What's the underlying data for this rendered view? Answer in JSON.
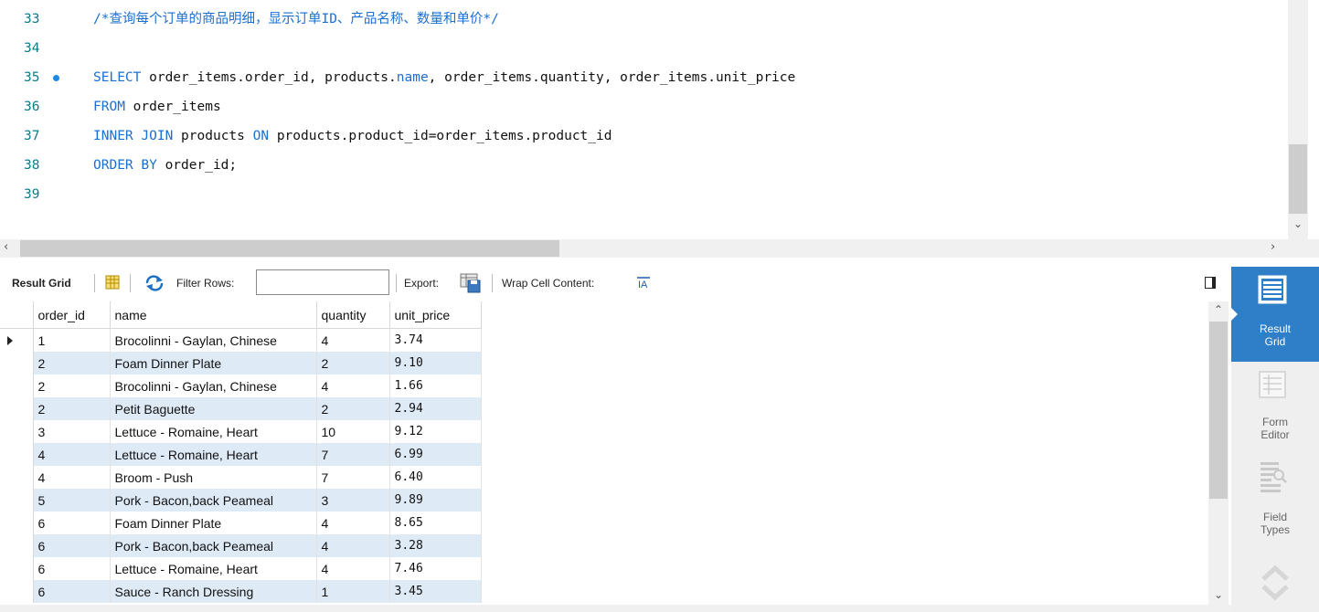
{
  "editor": {
    "lines": [
      {
        "num": "33",
        "parts": [
          {
            "t": "/*查询每个订单的商品明细，显示订单ID、产品名称、数量和单价*/",
            "k": "cm"
          }
        ]
      },
      {
        "num": "34",
        "parts": []
      },
      {
        "num": "35",
        "dot": true,
        "parts": [
          {
            "t": "SELECT",
            "k": "kw"
          },
          {
            "t": " order_items.order_id, products.",
            "k": ""
          },
          {
            "t": "name",
            "k": "kw"
          },
          {
            "t": ", order_items.quantity, order_items.unit_price",
            "k": ""
          }
        ]
      },
      {
        "num": "36",
        "parts": [
          {
            "t": "FROM",
            "k": "kw"
          },
          {
            "t": " order_items",
            "k": ""
          }
        ]
      },
      {
        "num": "37",
        "parts": [
          {
            "t": "INNER JOIN",
            "k": "kw"
          },
          {
            "t": " products ",
            "k": ""
          },
          {
            "t": "ON",
            "k": "kw"
          },
          {
            "t": " products.product_id=order_items.product_id",
            "k": ""
          }
        ]
      },
      {
        "num": "38",
        "parts": [
          {
            "t": "ORDER BY",
            "k": "kw"
          },
          {
            "t": " order_id;",
            "k": ""
          }
        ]
      },
      {
        "num": "39",
        "parts": []
      }
    ]
  },
  "toolbar": {
    "result_grid_label": "Result Grid",
    "filter_rows_label": "Filter Rows:",
    "filter_value": "",
    "export_label": "Export:",
    "wrap_label": "Wrap Cell Content:"
  },
  "grid": {
    "columns": [
      "order_id",
      "name",
      "quantity",
      "unit_price"
    ],
    "rows": [
      [
        "1",
        "Brocolinni - Gaylan, Chinese",
        "4",
        "3.74"
      ],
      [
        "2",
        "Foam Dinner Plate",
        "2",
        "9.10"
      ],
      [
        "2",
        "Brocolinni - Gaylan, Chinese",
        "4",
        "1.66"
      ],
      [
        "2",
        "Petit Baguette",
        "2",
        "2.94"
      ],
      [
        "3",
        "Lettuce - Romaine, Heart",
        "10",
        "9.12"
      ],
      [
        "4",
        "Lettuce - Romaine, Heart",
        "7",
        "6.99"
      ],
      [
        "4",
        "Broom - Push",
        "7",
        "6.40"
      ],
      [
        "5",
        "Pork - Bacon,back Peameal",
        "3",
        "9.89"
      ],
      [
        "6",
        "Foam Dinner Plate",
        "4",
        "8.65"
      ],
      [
        "6",
        "Pork - Bacon,back Peameal",
        "4",
        "3.28"
      ],
      [
        "6",
        "Lettuce - Romaine, Heart",
        "4",
        "7.46"
      ],
      [
        "6",
        "Sauce - Ranch Dressing",
        "1",
        "3.45"
      ]
    ]
  },
  "side_panel": {
    "items": [
      {
        "line1": "Result",
        "line2": "Grid",
        "icon": "result-grid-icon",
        "active": true
      },
      {
        "line1": "Form",
        "line2": "Editor",
        "icon": "form-editor-icon",
        "active": false
      },
      {
        "line1": "Field",
        "line2": "Types",
        "icon": "field-types-icon",
        "active": false
      }
    ]
  },
  "colors": {
    "keyword": "#1a6fd0",
    "line_number": "#0a7d86",
    "active_panel": "#2e7fc7",
    "row_alt": "#dfeaf7"
  }
}
